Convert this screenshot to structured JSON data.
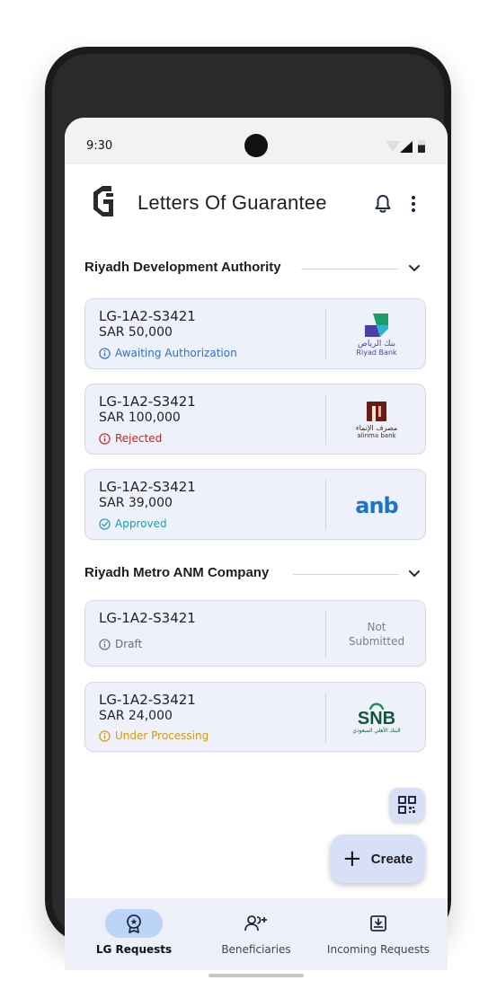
{
  "status_bar": {
    "time": "9:30"
  },
  "header": {
    "title": "Letters Of Guarantee"
  },
  "sections": [
    {
      "title": "Riyadh Development Authority",
      "cards": [
        {
          "lg_number": "LG-1A2-S3421",
          "amount": "SAR 50,000",
          "status": "Awaiting Authorization",
          "status_color": "#2f6fd6",
          "bank": "Riyad Bank",
          "bank_logo_text": "بنك الرياض",
          "bank_logo_sub": "Riyad Bank"
        },
        {
          "lg_number": "LG-1A2-S3421",
          "amount": "SAR 100,000",
          "status": "Rejected",
          "status_color": "#d32020",
          "bank": "alinma bank",
          "bank_logo_text": "مصرف الإنماء",
          "bank_logo_sub": "alinma bank"
        },
        {
          "lg_number": "LG-1A2-S3421",
          "amount": "SAR 39,000",
          "status": "Approved",
          "status_color": "#1a9fb0",
          "bank": "anb",
          "bank_logo_text": "anb"
        }
      ]
    },
    {
      "title": "Riyadh Metro ANM Company",
      "cards": [
        {
          "lg_number": "LG-1A2-S3421",
          "status": "Draft",
          "status_color": "#6d6d6d",
          "bank_placeholder": "Not Submitted",
          "bank_placeholder_line1": "Not",
          "bank_placeholder_line2": "Submitted"
        },
        {
          "lg_number": "LG-1A2-S3421",
          "amount": "SAR 24,000",
          "status": "Under Processing",
          "status_color": "#d39a16",
          "bank": "SNB",
          "bank_logo_text": "SNB",
          "bank_logo_sub": "البنك الأهلي السعودي"
        }
      ]
    }
  ],
  "fab": {
    "create_label": "Create",
    "qr_icon": "qr-code-icon"
  },
  "bottom_nav": [
    {
      "label": "LG Requests",
      "icon": "certificate-icon",
      "active": true
    },
    {
      "label": "Beneficiaries",
      "icon": "add-user-icon",
      "active": false
    },
    {
      "label": "Incoming Requests",
      "icon": "inbox-download-icon",
      "active": false
    }
  ],
  "colors": {
    "accent": "#bcd4f7",
    "card_bg": "#eef1f9",
    "fab_bg": "#d8e0f7"
  }
}
